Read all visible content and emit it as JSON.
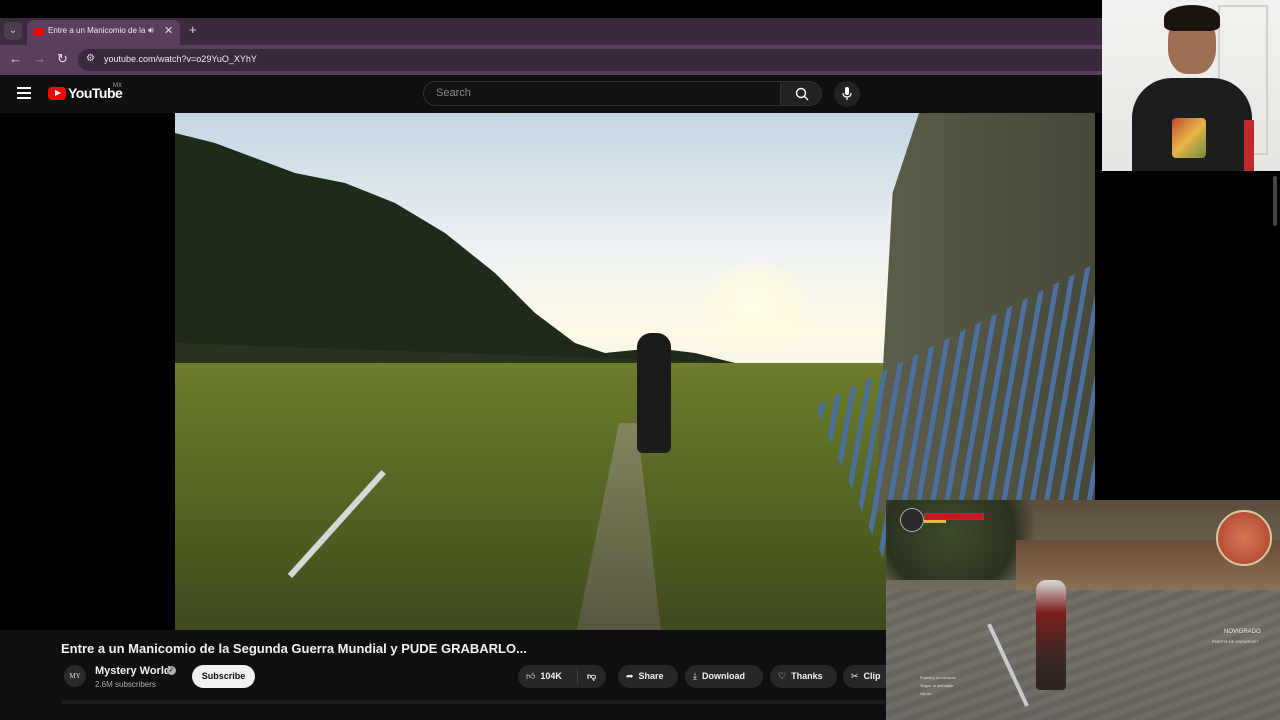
{
  "browser": {
    "tab_title": "Entre a un Manicomio de la",
    "url": "youtube.com/watch?v=o29YuO_XYhY",
    "new_tab_symbol": "+",
    "tab_close_symbol": "✕"
  },
  "youtube": {
    "logo_text": "YouTube",
    "country_code": "MX",
    "search_placeholder": "Search"
  },
  "video": {
    "title": "Entre a un Manicomio de la Segunda Guerra Mundial y PUDE GRABARLO...",
    "channel_name": "Mystery World",
    "channel_avatar_text": "MY",
    "subscribers": "2.6M subscribers",
    "subscribe_label": "Subscribe",
    "like_count": "104K",
    "share_label": "Share",
    "download_label": "Download",
    "thanks_label": "Thanks",
    "clip_label": "Clip"
  },
  "game_overlay": {
    "location": "NOVIGRADO",
    "sublocation": "PUERTA DE GNOMFURT",
    "quests": [
      "Puerta y un encanto",
      "Seguir al mercader",
      "Ver en"
    ]
  },
  "colors": {
    "browser_frame": "#5a3f5c",
    "youtube_bg": "#0f0f0f",
    "youtube_red": "#ff0000",
    "subscribe_bg": "#f1f1f1"
  },
  "icons": {
    "tab_favicon": "youtube-favicon-icon",
    "tab_audio": "speaker-icon",
    "back": "arrow-left-icon",
    "forward": "arrow-right-icon",
    "reload": "reload-icon",
    "site_info": "tune-icon",
    "menu": "hamburger-icon",
    "search": "search-icon",
    "mic": "microphone-icon",
    "like": "thumbs-up-icon",
    "dislike": "thumbs-down-icon",
    "share": "share-arrow-icon",
    "download": "download-icon",
    "thanks": "thanks-heart-icon",
    "clip": "scissors-icon",
    "verified": "verified-check-icon"
  }
}
